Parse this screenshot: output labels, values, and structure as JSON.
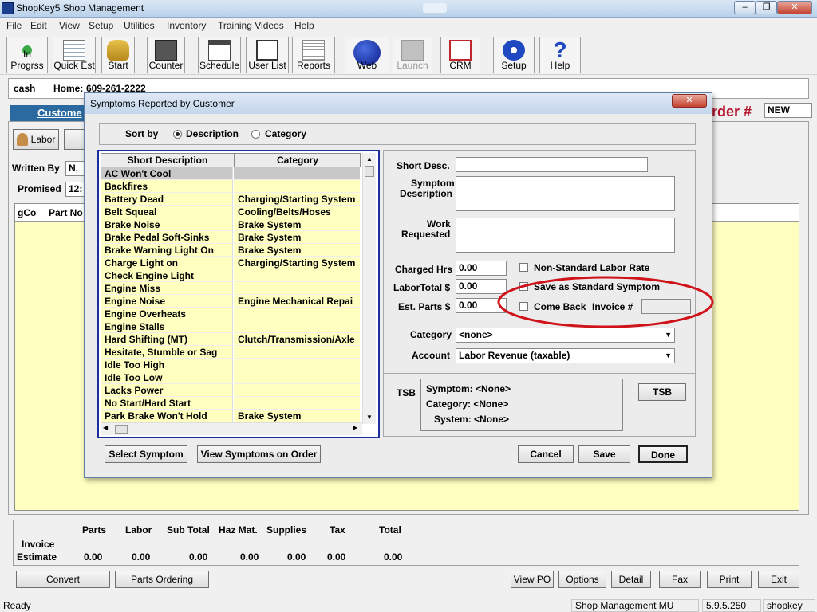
{
  "app": {
    "title": "ShopKey5 Shop Management"
  },
  "menu": [
    "File",
    "Edit",
    "View",
    "Setup",
    "Utilities",
    "Inventory",
    "Training Videos",
    "Help"
  ],
  "toolbar": {
    "buttons": [
      "In Progrss",
      "Quick Est",
      "Start",
      "Counter",
      "Schedule",
      "User List",
      "Reports",
      "Web",
      "Launch",
      "CRM",
      "Setup",
      "Help"
    ]
  },
  "customer": {
    "name": "cash",
    "home_label": "Home:",
    "home_phone": "609-261-2222"
  },
  "bg": {
    "customer_tab": "Custome",
    "order_label": "rder #",
    "order_value": "NEW",
    "labor_btn": "Labor",
    "written_by_label": "Written By",
    "written_by_value": "N,",
    "promised_label": "Promised",
    "promised_value": "12:",
    "col_gco": "gCo",
    "col_partno": "Part No"
  },
  "totals": {
    "headers": [
      "Parts",
      "Labor",
      "Sub Total",
      "Haz Mat.",
      "Supplies",
      "Tax",
      "Total"
    ],
    "row_labels": [
      "Invoice",
      "Estimate"
    ],
    "values": [
      "0.00",
      "0.00",
      "0.00",
      "0.00",
      "0.00",
      "0.00",
      "0.00"
    ]
  },
  "bottom_buttons": {
    "convert": "Convert",
    "parts_ordering": "Parts Ordering",
    "view_po": "View PO",
    "options": "Options",
    "detail": "Detail",
    "fax": "Fax",
    "print": "Print",
    "exit": "Exit"
  },
  "status": {
    "ready": "Ready",
    "module": "Shop Management MU",
    "version": "5.9.5.250",
    "user": "shopkey"
  },
  "dialog": {
    "title": "Symptoms Reported by Customer",
    "sort_by": "Sort by",
    "sort_desc": "Description",
    "sort_cat": "Category",
    "col_short": "Short Description",
    "col_cat": "Category",
    "rows": [
      {
        "desc": "AC Won't Cool",
        "cat": ""
      },
      {
        "desc": "Backfires",
        "cat": ""
      },
      {
        "desc": "Battery Dead",
        "cat": "Charging/Starting System"
      },
      {
        "desc": "Belt Squeal",
        "cat": "Cooling/Belts/Hoses"
      },
      {
        "desc": "Brake Noise",
        "cat": "Brake System"
      },
      {
        "desc": "Brake Pedal Soft-Sinks",
        "cat": "Brake System"
      },
      {
        "desc": "Brake Warning Light On",
        "cat": "Brake System"
      },
      {
        "desc": "Charge Light on",
        "cat": "Charging/Starting System"
      },
      {
        "desc": "Check Engine Light",
        "cat": ""
      },
      {
        "desc": "Engine Miss",
        "cat": ""
      },
      {
        "desc": "Engine Noise",
        "cat": "Engine Mechanical Repai"
      },
      {
        "desc": "Engine Overheats",
        "cat": ""
      },
      {
        "desc": "Engine Stalls",
        "cat": ""
      },
      {
        "desc": "Hard Shifting (MT)",
        "cat": "Clutch/Transmission/Axle"
      },
      {
        "desc": "Hesitate, Stumble or Sag",
        "cat": ""
      },
      {
        "desc": "Idle Too High",
        "cat": ""
      },
      {
        "desc": "Idle Too Low",
        "cat": ""
      },
      {
        "desc": "Lacks Power",
        "cat": ""
      },
      {
        "desc": "No Start/Hard Start",
        "cat": ""
      },
      {
        "desc": "Park Brake Won't Hold",
        "cat": "Brake System"
      }
    ],
    "short_desc_label": "Short Desc.",
    "symptom_desc_label_1": "Symptom",
    "symptom_desc_label_2": "Description",
    "work_req_label_1": "Work",
    "work_req_label_2": "Requested",
    "charged_hrs_label": "Charged Hrs",
    "charged_hrs": "0.00",
    "labor_total_label": "LaborTotal $",
    "labor_total": "0.00",
    "est_parts_label": "Est. Parts $",
    "est_parts": "0.00",
    "non_std": "Non-Standard Labor Rate",
    "save_std": "Save as Standard Symptom",
    "come_back": "Come Back",
    "invoice_label": "Invoice #",
    "category_label": "Category",
    "category_value": "<none>",
    "account_label": "Account",
    "account_value": "Labor Revenue (taxable)",
    "tsb_label": "TSB",
    "tsb_symptom": "Symptom: <None>",
    "tsb_category": "Category: <None>",
    "tsb_system": "System: <None>",
    "tsb_btn": "TSB",
    "select_symptom": "Select Symptom",
    "view_symptoms": "View Symptoms on Order",
    "cancel": "Cancel",
    "save": "Save",
    "done": "Done",
    "highlight_color": "#d0121b"
  }
}
